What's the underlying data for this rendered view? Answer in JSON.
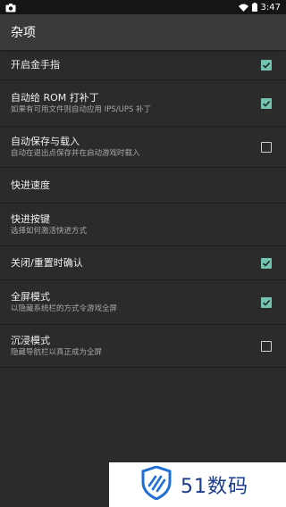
{
  "status_bar": {
    "time": "3:47"
  },
  "app_bar": {
    "title": "杂项"
  },
  "settings": [
    {
      "title": "开启金手指",
      "summary": "",
      "checkbox": true,
      "checked": true
    },
    {
      "title": "自动给 ROM 打补丁",
      "summary": "如果有可用文件则自动应用 IPS/UPS 补丁",
      "checkbox": true,
      "checked": true
    },
    {
      "title": "自动保存与载入",
      "summary": "自动在退出点保存并在启动游戏时载入",
      "checkbox": true,
      "checked": false
    },
    {
      "title": "快进速度",
      "summary": "",
      "checkbox": false,
      "checked": false
    },
    {
      "title": "快进按键",
      "summary": "选择如何激活快进方式",
      "checkbox": false,
      "checked": false
    },
    {
      "title": "关闭/重置时确认",
      "summary": "",
      "checkbox": true,
      "checked": true
    },
    {
      "title": "全屏模式",
      "summary": "以隐藏系统栏的方式令游戏全屏",
      "checkbox": true,
      "checked": true
    },
    {
      "title": "沉浸模式",
      "summary": "隐藏导航栏以真正成为全屏",
      "checkbox": true,
      "checked": false
    }
  ],
  "watermark": {
    "text": "51数码"
  },
  "colors": {
    "accent": "#73c3b0",
    "background": "#2b2b2b",
    "app_bar": "#3a3a3a"
  }
}
